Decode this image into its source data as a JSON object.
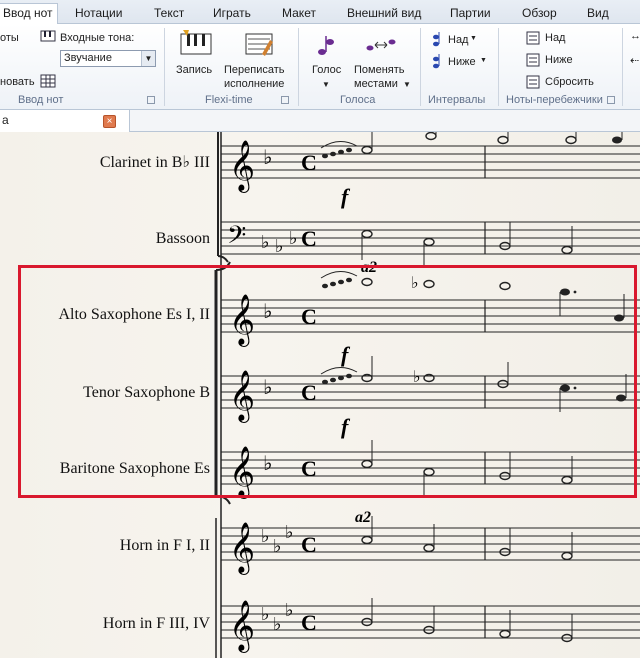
{
  "tabs": [
    "Ввод нот",
    "Нотации",
    "Текст",
    "Играть",
    "Макет",
    "Внешний вид",
    "Партии",
    "Обзор",
    "Вид"
  ],
  "active_tab": "Ввод нот",
  "ribbon": {
    "group1": {
      "cut_label_1": "оты",
      "cut_label_2": "новать",
      "input_tones_label": "Входные тона:",
      "input_tones_value": "Звучание",
      "title": "Ввод нот"
    },
    "flexi": {
      "record_label": "Запись",
      "rewrite_label_1": "Переписать",
      "rewrite_label_2": "исполнение",
      "title": "Flexi-time"
    },
    "voice": {
      "voice_label": "Голос",
      "swap_label_1": "Поменять",
      "swap_label_2": "местами",
      "title": "Голоса"
    },
    "intervals": {
      "above_label": "Над",
      "below_label": "Ниже",
      "title": "Интервалы"
    },
    "switchers": {
      "above_label": "Над",
      "below_label": "Ниже",
      "reset_label": "Сбросить",
      "title": "Ноты-перебежчики"
    }
  },
  "doc_tab": {
    "title": "а",
    "close_symbol": "×"
  },
  "score": {
    "instruments": [
      "Clarinet in B♭ III",
      "Bassoon",
      "Alto Saxophone Es I, II",
      "Tenor Saxophone B",
      "Baritone Saxophone Es",
      "Horn in F I, II",
      "Horn in F III, IV"
    ],
    "dynamics": [
      "f",
      "f",
      "f"
    ],
    "a2_marks": [
      "a2",
      "a2"
    ],
    "time_signature": "C"
  },
  "colors": {
    "selection": "#d9182e",
    "paper": "#f4f1ea",
    "accent": "#2f6ea8"
  }
}
